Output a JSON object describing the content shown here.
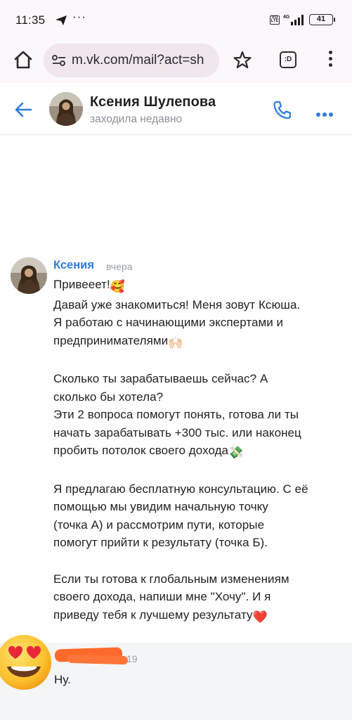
{
  "status_bar": {
    "time": "11:35",
    "dots": "···",
    "network": "4G",
    "battery": "41"
  },
  "browser": {
    "url": "m.vk.com/mail?act=sh",
    "tabs_label": ":D"
  },
  "chat_header": {
    "name": "Ксения Шулепова",
    "status": "заходила недавно"
  },
  "message": {
    "author": "Ксения",
    "time": "вчера",
    "paragraphs": [
      {
        "text": "Привееет!",
        "emoji": "🥰"
      },
      {
        "text": "\nДавай уже знакомиться! Меня зовут Ксюша.\nЯ работаю с начинающими экспертами и\nпредпринимателями",
        "emoji": "🙌🏻"
      },
      {
        "text": "\n\nСколько ты зарабатываешь сейчас? А\nсколько бы хотела?\nЭти 2 вопроса помогут понять, готова ли ты\nначать зарабатывать +300 тыс. или наконец\nпробить потолок своего дохода",
        "emoji": "💸"
      },
      {
        "text": "\n\nЯ предлагаю бесплатную консультацию. С её\nпомощью мы увидим начальную точку\n(точка А) и рассмотрим пути, которые\nпомогут прийти к результату (точка Б).\n\nЕсли ты готова к глобальным изменениям\nсвоего дохода, напиши мне \"Хочу\". И я\nприведу тебя к лучшему результату",
        "emoji": "❤️"
      }
    ]
  },
  "reply": {
    "time": "19",
    "text": "Ну."
  },
  "colors": {
    "vk_blue": "#2f7de1",
    "muted": "#8c9198",
    "redaction": "#ff6a2a"
  },
  "icons": [
    "send-icon",
    "volte-icon",
    "signal-icon",
    "battery-icon",
    "home-icon",
    "tune-icon",
    "star-icon",
    "tabs-icon",
    "menu-icon",
    "back-arrow-icon",
    "phone-icon",
    "more-icon",
    "heart-eyes-emoji"
  ]
}
